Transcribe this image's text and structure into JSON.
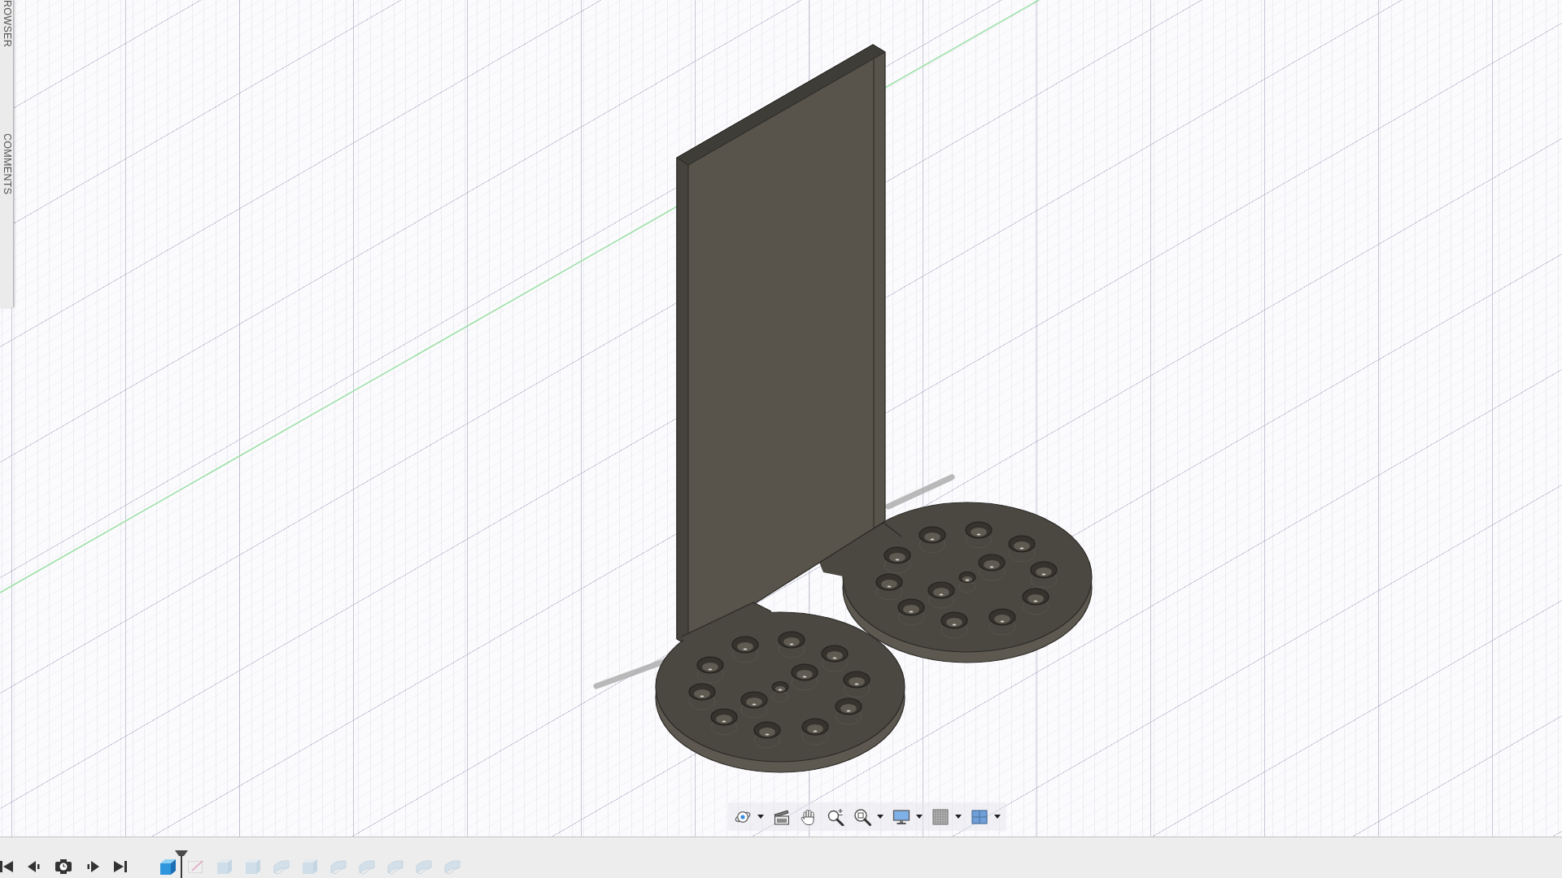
{
  "side_panels": [
    {
      "label": "ROWSER"
    },
    {
      "label": "COMMENTS"
    }
  ],
  "navigation_toolbar": [
    {
      "kind": "orbit",
      "dropdown": true
    },
    {
      "kind": "look_at",
      "dropdown": false
    },
    {
      "kind": "pan",
      "dropdown": false
    },
    {
      "kind": "zoom",
      "dropdown": false
    },
    {
      "kind": "zoom_window",
      "dropdown": true
    },
    {
      "kind": "display",
      "dropdown": true
    },
    {
      "kind": "grid",
      "dropdown": true
    },
    {
      "kind": "viewports",
      "dropdown": true
    }
  ],
  "timeline": {
    "controls": [
      {
        "kind": "first"
      },
      {
        "kind": "previous"
      },
      {
        "kind": "play"
      },
      {
        "kind": "next"
      },
      {
        "kind": "last"
      }
    ],
    "features": [
      {
        "kind": "body",
        "rolled_back": false
      },
      {
        "kind": "sketch",
        "rolled_back": true
      },
      {
        "kind": "extrude",
        "rolled_back": true
      },
      {
        "kind": "extrude",
        "rolled_back": true
      },
      {
        "kind": "fillet",
        "rolled_back": true
      },
      {
        "kind": "extrude",
        "rolled_back": true
      },
      {
        "kind": "fillet",
        "rolled_back": true
      },
      {
        "kind": "fillet",
        "rolled_back": true
      },
      {
        "kind": "fillet",
        "rolled_back": true
      },
      {
        "kind": "fillet",
        "rolled_back": true
      },
      {
        "kind": "fillet",
        "rolled_back": true
      }
    ]
  }
}
